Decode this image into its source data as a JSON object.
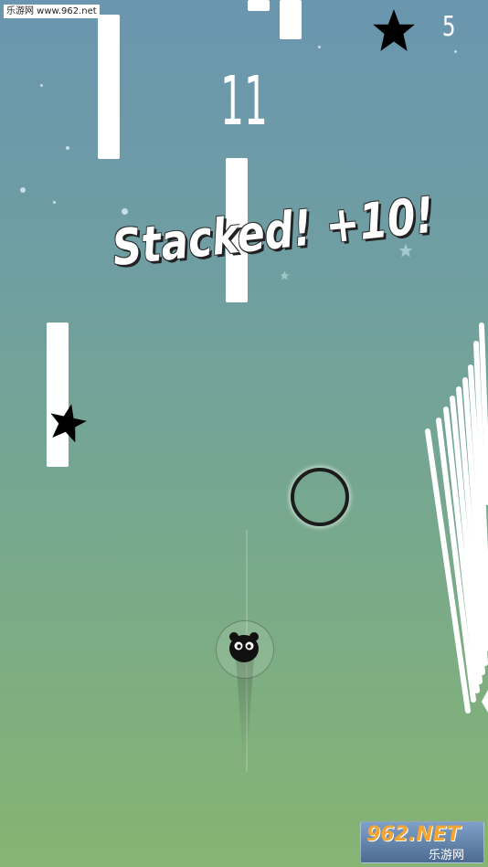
{
  "watermark_top": "乐游网 www.962.net",
  "hud": {
    "star_icon": "star-icon",
    "star_count": "5",
    "score": "11"
  },
  "popup": {
    "text": "Stacked! +10!"
  },
  "logo": {
    "main": "962.NET",
    "sub": "乐游网"
  },
  "colors": {
    "background_top": "#6a96af",
    "background_bottom": "#86b472",
    "bars": "#ffffff",
    "ring": "#1c1c1c",
    "hud_star": "#000000"
  },
  "icons": [
    "star-icon",
    "player-panda-icon",
    "ring-target-icon"
  ]
}
